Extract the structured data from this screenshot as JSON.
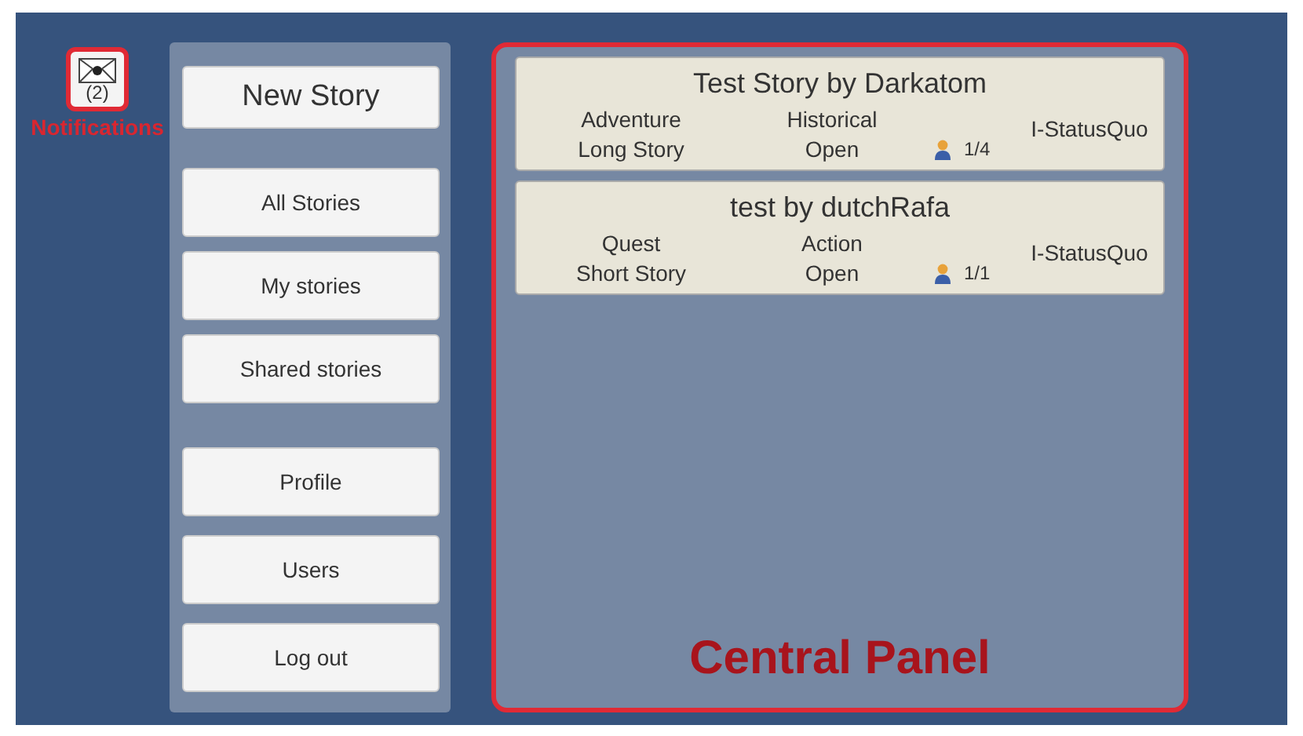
{
  "notifications": {
    "count": "(2)",
    "label": "Notifications"
  },
  "menu_groups": [
    [
      {
        "label": "New Story",
        "kind": "primary"
      }
    ],
    [
      {
        "label": "All Stories",
        "kind": "normal"
      },
      {
        "label": "My stories",
        "kind": "normal"
      },
      {
        "label": "Shared stories",
        "kind": "normal"
      }
    ],
    [
      {
        "label": "Profile",
        "kind": "normal"
      },
      {
        "label": "Users",
        "kind": "normal"
      },
      {
        "label": "Log out",
        "kind": "normal"
      }
    ]
  ],
  "stories": [
    {
      "title": "Test Story by Darkatom",
      "genre": "Adventure",
      "subgenre": "Historical",
      "tag": "I-StatusQuo",
      "length": "Long Story",
      "status": "Open",
      "players": "1/4"
    },
    {
      "title": "test by dutchRafa",
      "genre": "Quest",
      "subgenre": "Action",
      "tag": "I-StatusQuo",
      "length": "Short Story",
      "status": "Open",
      "players": "1/1"
    }
  ],
  "central_panel_label": "Central Panel"
}
